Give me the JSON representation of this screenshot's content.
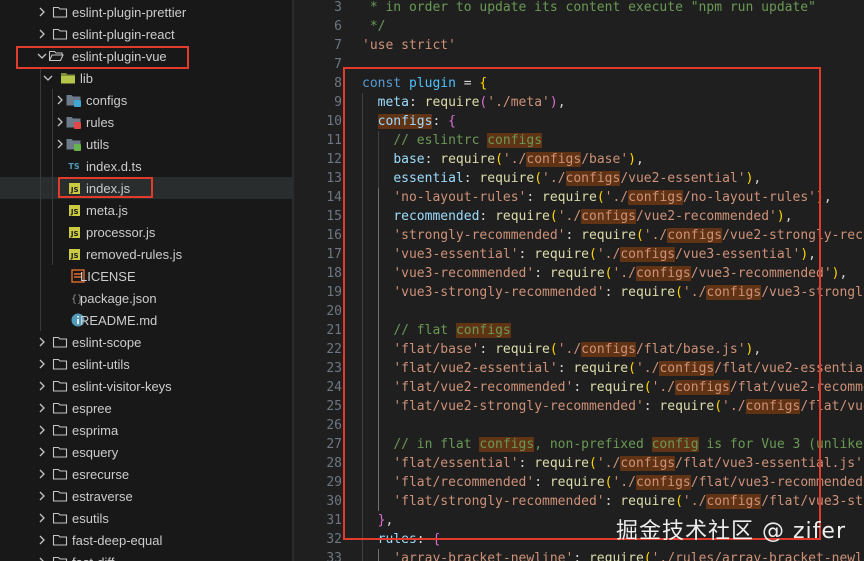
{
  "explorer": {
    "items": [
      {
        "label": "eslint-plugin-prettier",
        "type": "folder",
        "open": false,
        "depth": 1
      },
      {
        "label": "eslint-plugin-react",
        "type": "folder",
        "open": false,
        "depth": 1
      },
      {
        "label": "eslint-plugin-vue",
        "type": "folder",
        "open": true,
        "depth": 1
      },
      {
        "label": "lib",
        "type": "folder",
        "open": true,
        "depth": 2
      },
      {
        "label": "configs",
        "type": "folder-configs",
        "open": false,
        "depth": 3
      },
      {
        "label": "rules",
        "type": "folder-rules",
        "open": false,
        "depth": 3
      },
      {
        "label": "utils",
        "type": "folder-utils",
        "open": false,
        "depth": 3
      },
      {
        "label": "index.d.ts",
        "type": "ts",
        "depth": 3
      },
      {
        "label": "index.js",
        "type": "js",
        "depth": 3,
        "selected": true
      },
      {
        "label": "meta.js",
        "type": "js",
        "depth": 3
      },
      {
        "label": "processor.js",
        "type": "js",
        "depth": 3
      },
      {
        "label": "removed-rules.js",
        "type": "js",
        "depth": 3
      },
      {
        "label": "LICENSE",
        "type": "license",
        "depth": 2
      },
      {
        "label": "package.json",
        "type": "json",
        "depth": 2
      },
      {
        "label": "README.md",
        "type": "info",
        "depth": 2
      },
      {
        "label": "eslint-scope",
        "type": "folder",
        "open": false,
        "depth": 1
      },
      {
        "label": "eslint-utils",
        "type": "folder",
        "open": false,
        "depth": 1
      },
      {
        "label": "eslint-visitor-keys",
        "type": "folder",
        "open": false,
        "depth": 1
      },
      {
        "label": "espree",
        "type": "folder",
        "open": false,
        "depth": 1
      },
      {
        "label": "esprima",
        "type": "folder",
        "open": false,
        "depth": 1
      },
      {
        "label": "esquery",
        "type": "folder",
        "open": false,
        "depth": 1
      },
      {
        "label": "esrecurse",
        "type": "folder",
        "open": false,
        "depth": 1
      },
      {
        "label": "estraverse",
        "type": "folder",
        "open": false,
        "depth": 1
      },
      {
        "label": "esutils",
        "type": "folder",
        "open": false,
        "depth": 1
      },
      {
        "label": "fast-deep-equal",
        "type": "folder",
        "open": false,
        "depth": 1
      },
      {
        "label": "fast-diff",
        "type": "folder",
        "open": false,
        "depth": 1
      }
    ]
  },
  "editor": {
    "lines": [
      {
        "n": "3",
        "indent": 0,
        "tokens": [
          [
            " * in order to update its content execute \"npm run update\"",
            "cmt"
          ]
        ]
      },
      {
        "n": "6",
        "indent": 0,
        "tokens": [
          [
            " */",
            "cmt"
          ]
        ]
      },
      {
        "n": "7",
        "indent": 0,
        "tokens": [
          [
            "'use strict'",
            "str"
          ]
        ]
      },
      {
        "n": "7",
        "indent": 0,
        "tokens": []
      },
      {
        "n": "8",
        "indent": 0,
        "tokens": [
          [
            "const ",
            "kw"
          ],
          [
            "plugin",
            "var"
          ],
          [
            " = ",
            "punc"
          ],
          [
            "{",
            "brace"
          ]
        ]
      },
      {
        "n": "9",
        "indent": 1,
        "tokens": [
          [
            "meta",
            "prop"
          ],
          [
            ": ",
            "punc"
          ],
          [
            "require",
            "fn"
          ],
          [
            "(",
            "brace2"
          ],
          [
            "'./meta'",
            "str"
          ],
          [
            ")",
            "brace2"
          ],
          [
            ",",
            "punc"
          ]
        ]
      },
      {
        "n": "10",
        "indent": 1,
        "tokens": [
          [
            "configs",
            "prop",
            "hl"
          ],
          [
            ": ",
            "punc"
          ],
          [
            "{",
            "brace2"
          ]
        ]
      },
      {
        "n": "11",
        "indent": 2,
        "tokens": [
          [
            "// eslintrc ",
            "cmt"
          ],
          [
            "configs",
            "cmt",
            "hl"
          ]
        ]
      },
      {
        "n": "12",
        "indent": 2,
        "tokens": [
          [
            "base",
            "prop"
          ],
          [
            ": ",
            "punc"
          ],
          [
            "require",
            "fn"
          ],
          [
            "(",
            "brace"
          ],
          [
            "'./",
            "str"
          ],
          [
            "configs",
            "str",
            "hl"
          ],
          [
            "/base'",
            "str"
          ],
          [
            ")",
            "brace"
          ],
          [
            ",",
            "punc"
          ]
        ]
      },
      {
        "n": "13",
        "indent": 2,
        "tokens": [
          [
            "essential",
            "prop"
          ],
          [
            ": ",
            "punc"
          ],
          [
            "require",
            "fn"
          ],
          [
            "(",
            "brace"
          ],
          [
            "'./",
            "str"
          ],
          [
            "configs",
            "str",
            "hl"
          ],
          [
            "/vue2-essential'",
            "str"
          ],
          [
            ")",
            "brace"
          ],
          [
            ",",
            "punc"
          ]
        ]
      },
      {
        "n": "14",
        "indent": 2,
        "tokens": [
          [
            "'no-layout-rules'",
            "str"
          ],
          [
            ": ",
            "punc"
          ],
          [
            "require",
            "fn"
          ],
          [
            "(",
            "brace"
          ],
          [
            "'./",
            "str"
          ],
          [
            "configs",
            "str",
            "hl"
          ],
          [
            "/no-layout-rules'",
            "str"
          ],
          [
            ")",
            "brace"
          ],
          [
            ",",
            "punc"
          ]
        ]
      },
      {
        "n": "15",
        "indent": 2,
        "tokens": [
          [
            "recommended",
            "prop"
          ],
          [
            ": ",
            "punc"
          ],
          [
            "require",
            "fn"
          ],
          [
            "(",
            "brace"
          ],
          [
            "'./",
            "str"
          ],
          [
            "configs",
            "str",
            "hl"
          ],
          [
            "/vue2-recommended'",
            "str"
          ],
          [
            ")",
            "brace"
          ],
          [
            ",",
            "punc"
          ]
        ]
      },
      {
        "n": "16",
        "indent": 2,
        "tokens": [
          [
            "'strongly-recommended'",
            "str"
          ],
          [
            ": ",
            "punc"
          ],
          [
            "require",
            "fn"
          ],
          [
            "(",
            "brace"
          ],
          [
            "'./",
            "str"
          ],
          [
            "configs",
            "str",
            "hl"
          ],
          [
            "/vue2-strongly-reco",
            "str"
          ]
        ]
      },
      {
        "n": "17",
        "indent": 2,
        "tokens": [
          [
            "'vue3-essential'",
            "str"
          ],
          [
            ": ",
            "punc"
          ],
          [
            "require",
            "fn"
          ],
          [
            "(",
            "brace"
          ],
          [
            "'./",
            "str"
          ],
          [
            "configs",
            "str",
            "hl"
          ],
          [
            "/vue3-essential'",
            "str"
          ],
          [
            ")",
            "brace"
          ],
          [
            ",",
            "punc"
          ]
        ]
      },
      {
        "n": "18",
        "indent": 2,
        "tokens": [
          [
            "'vue3-recommended'",
            "str"
          ],
          [
            ": ",
            "punc"
          ],
          [
            "require",
            "fn"
          ],
          [
            "(",
            "brace"
          ],
          [
            "'./",
            "str"
          ],
          [
            "configs",
            "str",
            "hl"
          ],
          [
            "/vue3-recommended'",
            "str"
          ],
          [
            ")",
            "brace"
          ],
          [
            ",",
            "punc"
          ]
        ]
      },
      {
        "n": "19",
        "indent": 2,
        "tokens": [
          [
            "'vue3-strongly-recommended'",
            "str"
          ],
          [
            ": ",
            "punc"
          ],
          [
            "require",
            "fn"
          ],
          [
            "(",
            "brace"
          ],
          [
            "'./",
            "str"
          ],
          [
            "configs",
            "str",
            "hl"
          ],
          [
            "/vue3-strongly",
            "str"
          ]
        ]
      },
      {
        "n": "20",
        "indent": 2,
        "tokens": []
      },
      {
        "n": "21",
        "indent": 2,
        "tokens": [
          [
            "// flat ",
            "cmt"
          ],
          [
            "configs",
            "cmt",
            "hl"
          ]
        ]
      },
      {
        "n": "22",
        "indent": 2,
        "tokens": [
          [
            "'flat/base'",
            "str"
          ],
          [
            ": ",
            "punc"
          ],
          [
            "require",
            "fn"
          ],
          [
            "(",
            "brace"
          ],
          [
            "'./",
            "str"
          ],
          [
            "configs",
            "str",
            "hl"
          ],
          [
            "/flat/base.js'",
            "str"
          ],
          [
            ")",
            "brace"
          ],
          [
            ",",
            "punc"
          ]
        ]
      },
      {
        "n": "23",
        "indent": 2,
        "tokens": [
          [
            "'flat/vue2-essential'",
            "str"
          ],
          [
            ": ",
            "punc"
          ],
          [
            "require",
            "fn"
          ],
          [
            "(",
            "brace"
          ],
          [
            "'./",
            "str"
          ],
          [
            "configs",
            "str",
            "hl"
          ],
          [
            "/flat/vue2-essential",
            "str"
          ]
        ]
      },
      {
        "n": "24",
        "indent": 2,
        "tokens": [
          [
            "'flat/vue2-recommended'",
            "str"
          ],
          [
            ": ",
            "punc"
          ],
          [
            "require",
            "fn"
          ],
          [
            "(",
            "brace"
          ],
          [
            "'./",
            "str"
          ],
          [
            "configs",
            "str",
            "hl"
          ],
          [
            "/flat/vue2-recomme",
            "str"
          ]
        ]
      },
      {
        "n": "25",
        "indent": 2,
        "tokens": [
          [
            "'flat/vue2-strongly-recommended'",
            "str"
          ],
          [
            ": ",
            "punc"
          ],
          [
            "require",
            "fn"
          ],
          [
            "(",
            "brace"
          ],
          [
            "'./",
            "str"
          ],
          [
            "configs",
            "str",
            "hl"
          ],
          [
            "/flat/vue2",
            "str"
          ]
        ]
      },
      {
        "n": "26",
        "indent": 2,
        "tokens": []
      },
      {
        "n": "27",
        "indent": 2,
        "tokens": [
          [
            "// in flat ",
            "cmt"
          ],
          [
            "configs",
            "cmt",
            "hl"
          ],
          [
            ", non-prefixed ",
            "cmt"
          ],
          [
            "config",
            "cmt",
            "hl"
          ],
          [
            " is for Vue 3 (unlike e",
            "cmt"
          ]
        ]
      },
      {
        "n": "28",
        "indent": 2,
        "tokens": [
          [
            "'flat/essential'",
            "str"
          ],
          [
            ": ",
            "punc"
          ],
          [
            "require",
            "fn"
          ],
          [
            "(",
            "brace"
          ],
          [
            "'./",
            "str"
          ],
          [
            "configs",
            "str",
            "hl"
          ],
          [
            "/flat/vue3-essential.js'",
            "str"
          ],
          [
            ")",
            "brace"
          ]
        ]
      },
      {
        "n": "29",
        "indent": 2,
        "tokens": [
          [
            "'flat/recommended'",
            "str"
          ],
          [
            ": ",
            "punc"
          ],
          [
            "require",
            "fn"
          ],
          [
            "(",
            "brace"
          ],
          [
            "'./",
            "str"
          ],
          [
            "configs",
            "str",
            "hl"
          ],
          [
            "/flat/vue3-recommended.",
            "str"
          ]
        ]
      },
      {
        "n": "30",
        "indent": 2,
        "tokens": [
          [
            "'flat/strongly-recommended'",
            "str"
          ],
          [
            ": ",
            "punc"
          ],
          [
            "require",
            "fn"
          ],
          [
            "(",
            "brace"
          ],
          [
            "'./",
            "str"
          ],
          [
            "configs",
            "str",
            "hl"
          ],
          [
            "/flat/vue3-stro",
            "str"
          ]
        ]
      },
      {
        "n": "31",
        "indent": 1,
        "tokens": [
          [
            "}",
            "brace2"
          ],
          [
            ",",
            "punc"
          ]
        ]
      },
      {
        "n": "32",
        "indent": 1,
        "tokens": [
          [
            "rules",
            "prop"
          ],
          [
            ": ",
            "punc"
          ],
          [
            "{",
            "brace2"
          ]
        ]
      },
      {
        "n": "33",
        "indent": 2,
        "tokens": [
          [
            "'array-bracket-newline'",
            "str"
          ],
          [
            ": ",
            "punc"
          ],
          [
            "require",
            "fn"
          ],
          [
            "(",
            "brace"
          ],
          [
            "'./rules/array-bracket-newli",
            "str"
          ]
        ]
      }
    ]
  },
  "watermark": "掘金技术社区 @ zifer"
}
